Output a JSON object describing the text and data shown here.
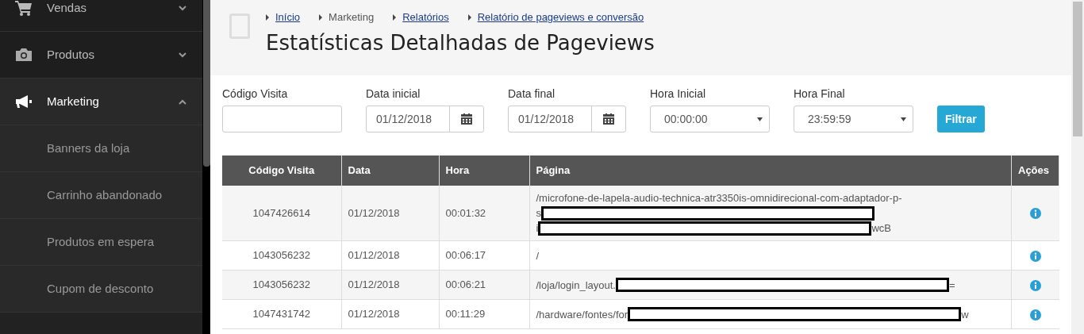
{
  "sidebar": {
    "items": [
      {
        "label": "Vendas",
        "kind": "cart",
        "expanded": false,
        "selected": false
      },
      {
        "label": "Produtos",
        "kind": "camera",
        "expanded": false,
        "selected": false
      },
      {
        "label": "Marketing",
        "kind": "megaphone",
        "expanded": true,
        "selected": true,
        "children": [
          {
            "label": "Banners da loja"
          },
          {
            "label": "Carrinho abandonado"
          },
          {
            "label": "Produtos em espera"
          },
          {
            "label": "Cupom de desconto"
          }
        ]
      }
    ]
  },
  "breadcrumb": [
    {
      "label": "Início",
      "link": true
    },
    {
      "label": "Marketing",
      "link": false
    },
    {
      "label": "Relatórios",
      "link": true
    },
    {
      "label": "Relatório de pageviews e conversão",
      "link": true
    }
  ],
  "title": "Estatísticas Detalhadas de Pageviews",
  "filters": [
    {
      "label": "Código Visita",
      "kind": "text"
    },
    {
      "label": "Data inicial",
      "kind": "date",
      "value": "01/12/2018"
    },
    {
      "label": "Data final",
      "kind": "date",
      "value": "01/12/2018"
    },
    {
      "label": "Hora Inicial",
      "kind": "select",
      "value": "00:00:00"
    },
    {
      "label": "Hora Final",
      "kind": "select",
      "value": "23:59:59"
    }
  ],
  "filter_button": "Filtrar",
  "table": {
    "columns": [
      "Código Visita",
      "Data",
      "Hora",
      "Página",
      "Ações"
    ],
    "rows": [
      {
        "code": "1047426614",
        "date": "01/12/2018",
        "time": "00:01:32",
        "page": [
          {
            "before": "/microfone-de-lapela-audio-technica-atr3350is-omnidirecional-com-adaptador-p-",
            "redacted": false
          },
          {
            "before": "s",
            "redacted": true
          },
          {
            "before": "i",
            "after": "wcB",
            "redacted": true
          }
        ]
      },
      {
        "code": "1043056232",
        "date": "01/12/2018",
        "time": "00:06:17",
        "page": [
          {
            "before": "/",
            "redacted": false
          }
        ]
      },
      {
        "code": "1043056232",
        "date": "01/12/2018",
        "time": "00:06:21",
        "page": [
          {
            "before": "/loja/login_layout.",
            "after": "=",
            "redacted": true
          }
        ]
      },
      {
        "code": "1047431742",
        "date": "01/12/2018",
        "time": "00:11:29",
        "page": [
          {
            "before": "/hardware/fontes/for",
            "after": "w",
            "redacted": true
          }
        ]
      }
    ]
  }
}
